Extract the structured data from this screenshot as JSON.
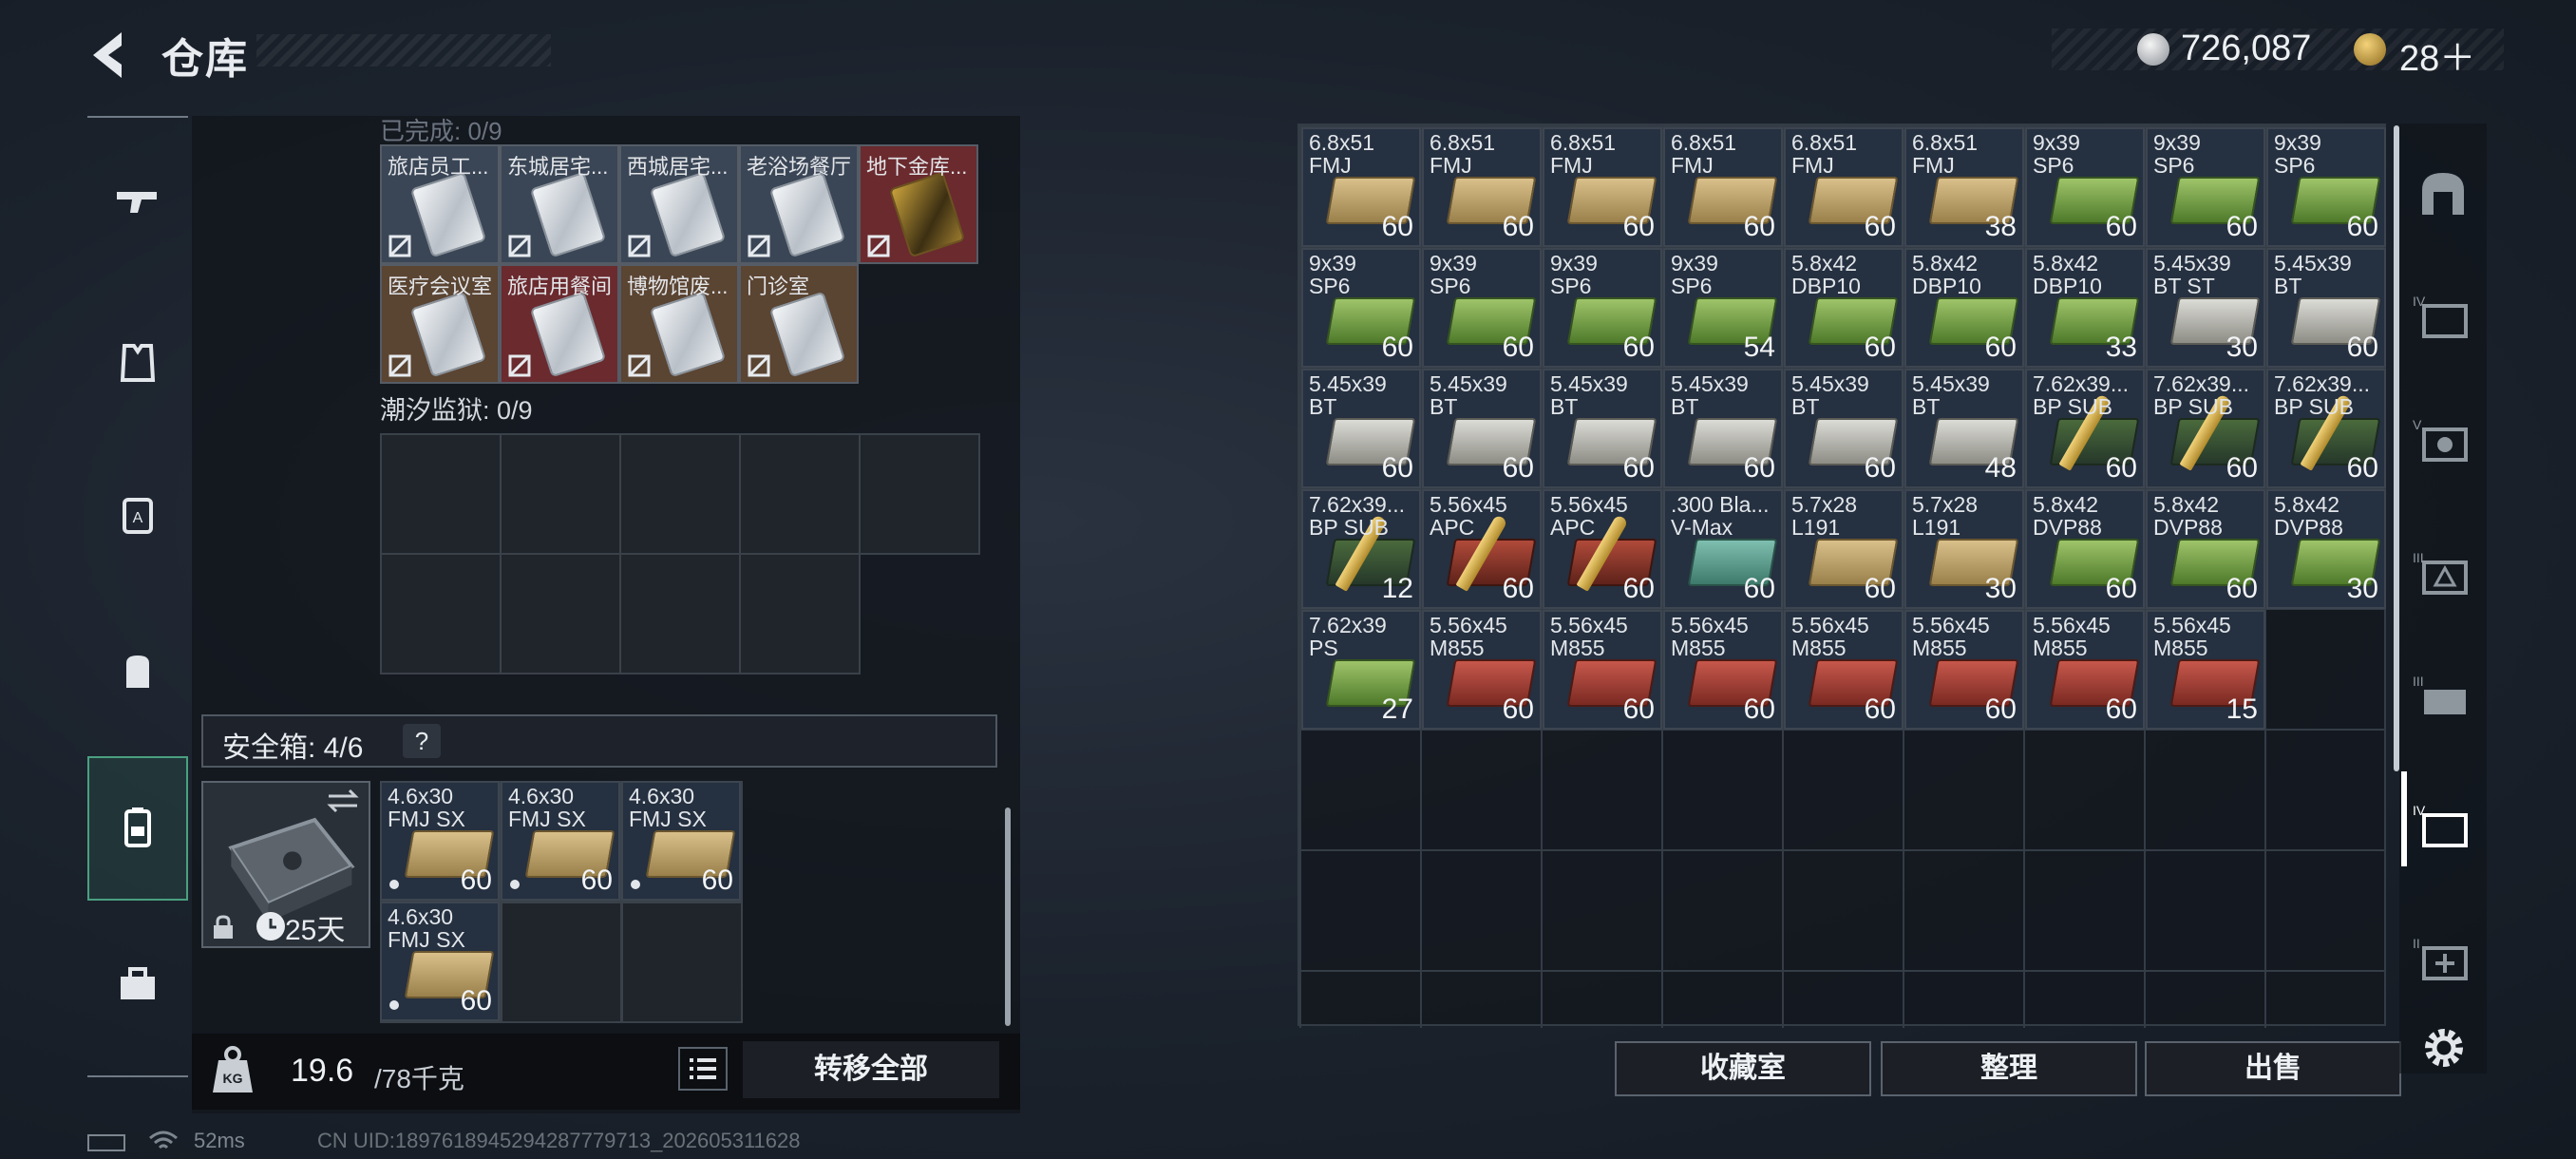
{
  "header": {
    "title": "仓库",
    "silver_amount": "726,087",
    "gold_amount": "28＋"
  },
  "left_panel": {
    "partial_label": "已完成: 0/9",
    "key_cards": [
      {
        "name": "旅店员工...",
        "bg": "#3a4656",
        "img": "silver"
      },
      {
        "name": "东城居宅...",
        "bg": "#3a4656",
        "img": "silver"
      },
      {
        "name": "西城居宅...",
        "bg": "#3a4656",
        "img": "silver"
      },
      {
        "name": "老浴场餐厅",
        "bg": "#3a4656",
        "img": "silver"
      },
      {
        "name": "地下金库...",
        "bg": "#6a2a2e",
        "img": "gold"
      },
      {
        "name": "医疗会议室",
        "bg": "#5a4432",
        "img": "silver"
      },
      {
        "name": "旅店用餐间",
        "bg": "#6a2a2e",
        "img": "silver"
      },
      {
        "name": "博物馆废...",
        "bg": "#5a4432",
        "img": "silver"
      },
      {
        "name": "门诊室",
        "bg": "#5a4432",
        "img": "silver"
      }
    ],
    "prison_label": "潮汐监狱: 0/9",
    "safebox_label": "安全箱: 4/6",
    "safebox_help": "?",
    "safebox_days": "25天",
    "safebox_ammo": [
      {
        "name": "4.6x30\nFMJ SX",
        "count": "60",
        "color": "c-tan"
      },
      {
        "name": "4.6x30\nFMJ SX",
        "count": "60",
        "color": "c-tan"
      },
      {
        "name": "4.6x30\nFMJ SX",
        "count": "60",
        "color": "c-tan"
      },
      {
        "name": "4.6x30\nFMJ SX",
        "count": "60",
        "color": "c-tan"
      }
    ]
  },
  "weight": {
    "current": "19.6",
    "max": "/78千克",
    "transfer_label": "转移全部"
  },
  "stash_ammo": [
    {
      "name": "6.8x51\nFMJ",
      "count": "60",
      "color": "c-tan"
    },
    {
      "name": "6.8x51\nFMJ",
      "count": "60",
      "color": "c-tan"
    },
    {
      "name": "6.8x51\nFMJ",
      "count": "60",
      "color": "c-tan"
    },
    {
      "name": "6.8x51\nFMJ",
      "count": "60",
      "color": "c-tan"
    },
    {
      "name": "6.8x51\nFMJ",
      "count": "60",
      "color": "c-tan"
    },
    {
      "name": "6.8x51\nFMJ",
      "count": "38",
      "color": "c-tan"
    },
    {
      "name": "9x39\nSP6",
      "count": "60",
      "color": "c-green"
    },
    {
      "name": "9x39\nSP6",
      "count": "60",
      "color": "c-green"
    },
    {
      "name": "9x39\nSP6",
      "count": "60",
      "color": "c-green"
    },
    {
      "name": "9x39\nSP6",
      "count": "60",
      "color": "c-green"
    },
    {
      "name": "9x39\nSP6",
      "count": "60",
      "color": "c-green"
    },
    {
      "name": "9x39\nSP6",
      "count": "60",
      "color": "c-green"
    },
    {
      "name": "9x39\nSP6",
      "count": "54",
      "color": "c-green"
    },
    {
      "name": "5.8x42\nDBP10",
      "count": "60",
      "color": "c-green"
    },
    {
      "name": "5.8x42\nDBP10",
      "count": "60",
      "color": "c-green"
    },
    {
      "name": "5.8x42\nDBP10",
      "count": "33",
      "color": "c-green"
    },
    {
      "name": "5.45x39\nBT ST",
      "count": "30",
      "color": "c-silver"
    },
    {
      "name": "5.45x39\nBT",
      "count": "60",
      "color": "c-silver"
    },
    {
      "name": "5.45x39\nBT",
      "count": "60",
      "color": "c-silver"
    },
    {
      "name": "5.45x39\nBT",
      "count": "60",
      "color": "c-silver"
    },
    {
      "name": "5.45x39\nBT",
      "count": "60",
      "color": "c-silver"
    },
    {
      "name": "5.45x39\nBT",
      "count": "60",
      "color": "c-silver"
    },
    {
      "name": "5.45x39\nBT",
      "count": "60",
      "color": "c-silver"
    },
    {
      "name": "5.45x39\nBT",
      "count": "48",
      "color": "c-silver"
    },
    {
      "name": "7.62x39...\nBP SUB",
      "count": "60",
      "color": "c-bullet"
    },
    {
      "name": "7.62x39...\nBP SUB",
      "count": "60",
      "color": "c-bullet"
    },
    {
      "name": "7.62x39...\nBP SUB",
      "count": "60",
      "color": "c-bullet"
    },
    {
      "name": "7.62x39...\nBP SUB",
      "count": "12",
      "color": "c-bullet"
    },
    {
      "name": "5.56x45\nAPC",
      "count": "60",
      "color": "c-redbullet"
    },
    {
      "name": "5.56x45\nAPC",
      "count": "60",
      "color": "c-redbullet"
    },
    {
      "name": ".300 Bla...\nV-Max",
      "count": "60",
      "color": "c-teal"
    },
    {
      "name": "5.7x28\nL191",
      "count": "60",
      "color": "c-tan"
    },
    {
      "name": "5.7x28\nL191",
      "count": "30",
      "color": "c-tan"
    },
    {
      "name": "5.8x42\nDVP88",
      "count": "60",
      "color": "c-green"
    },
    {
      "name": "5.8x42\nDVP88",
      "count": "60",
      "color": "c-green"
    },
    {
      "name": "5.8x42\nDVP88",
      "count": "30",
      "color": "c-green"
    },
    {
      "name": "7.62x39\nPS",
      "count": "27",
      "color": "c-green"
    },
    {
      "name": "5.56x45\nM855",
      "count": "60",
      "color": "c-red"
    },
    {
      "name": "5.56x45\nM855",
      "count": "60",
      "color": "c-red"
    },
    {
      "name": "5.56x45\nM855",
      "count": "60",
      "color": "c-red"
    },
    {
      "name": "5.56x45\nM855",
      "count": "60",
      "color": "c-red"
    },
    {
      "name": "5.56x45\nM855",
      "count": "60",
      "color": "c-red"
    },
    {
      "name": "5.56x45\nM855",
      "count": "60",
      "color": "c-red"
    },
    {
      "name": "5.56x45\nM855",
      "count": "15",
      "color": "c-red"
    }
  ],
  "buttons": {
    "collection": "收藏室",
    "sort": "整理",
    "sell": "出售"
  },
  "status": {
    "ping": "52ms",
    "uid": "CN UID:1897618945294287779713_202605311628"
  }
}
